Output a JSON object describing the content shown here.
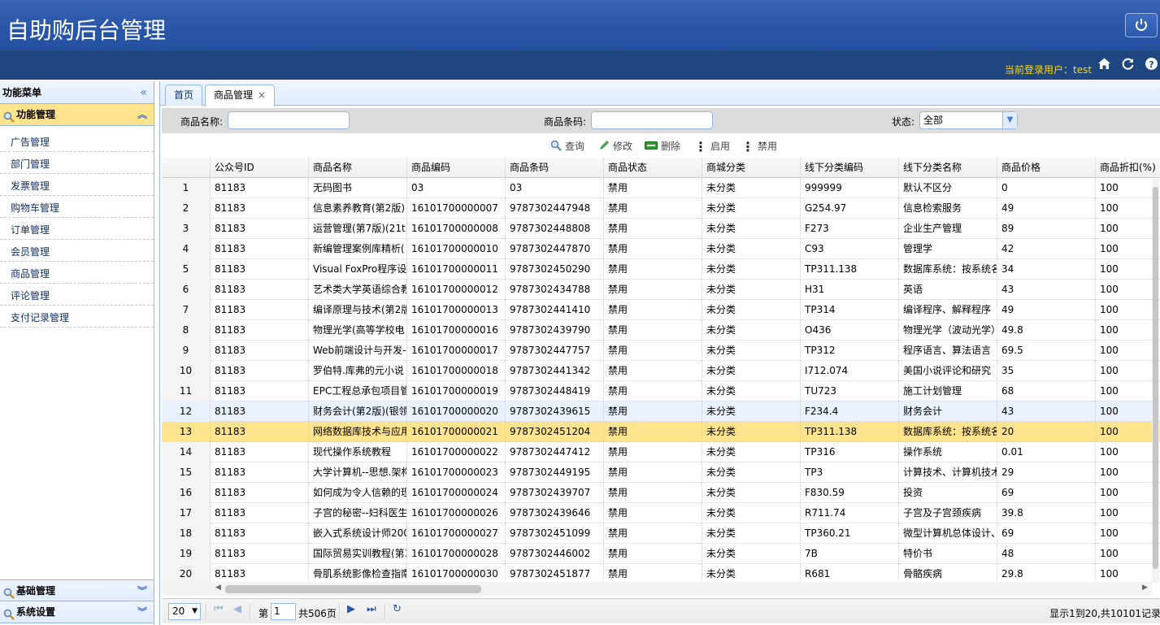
{
  "header": {
    "title": "自助购后台管理",
    "user_label": "当前登录用户：test"
  },
  "sidebar": {
    "title": "功能菜单",
    "active_group": "功能管理",
    "items": [
      "广告管理",
      "部门管理",
      "发票管理",
      "购物车管理",
      "订单管理",
      "会员管理",
      "商品管理",
      "评论管理",
      "支付记录管理"
    ],
    "bottom_groups": [
      "基础管理",
      "系统设置"
    ]
  },
  "tabs": [
    {
      "label": "首页"
    },
    {
      "label": "商品管理",
      "close": "×"
    }
  ],
  "search": {
    "name_label": "商品名称:",
    "barcode_label": "商品条码:",
    "status_label": "状态:",
    "status_value": "全部",
    "name_value": "",
    "barcode_value": ""
  },
  "toolbar": {
    "query": "查询",
    "edit": "修改",
    "delete": "删除",
    "enable": "启用",
    "disable": "禁用"
  },
  "grid": {
    "columns": [
      "公众号ID",
      "商品名称",
      "商品编码",
      "商品条码",
      "商品状态",
      "商城分类",
      "线下分类编码",
      "线下分类名称",
      "商品价格",
      "商品折扣(%)"
    ],
    "rows": [
      [
        "1",
        "81183",
        "无码图书",
        "03",
        "03",
        "禁用",
        "未分类",
        "999999",
        "默认不区分",
        "0",
        "100"
      ],
      [
        "2",
        "81183",
        "信息素养教育(第2版)",
        "16101700000007",
        "9787302447948",
        "禁用",
        "未分类",
        "G254.97",
        "信息检索服务",
        "49",
        "100"
      ],
      [
        "3",
        "81183",
        "运营管理(第7版)(21t",
        "16101700000008",
        "9787302448808",
        "禁用",
        "未分类",
        "F273",
        "企业生产管理",
        "89",
        "100"
      ],
      [
        "4",
        "81183",
        "新编管理案例库精析(",
        "16101700000010",
        "9787302447870",
        "禁用",
        "未分类",
        "C93",
        "管理学",
        "42",
        "100"
      ],
      [
        "5",
        "81183",
        "Visual FoxPro程序设",
        "16101700000011",
        "9787302450290",
        "禁用",
        "未分类",
        "TP311.138",
        "数据库系统：按系统名",
        "34",
        "100"
      ],
      [
        "6",
        "81183",
        "艺术类大学英语综合教",
        "16101700000012",
        "9787302434788",
        "禁用",
        "未分类",
        "H31",
        "英语",
        "43",
        "100"
      ],
      [
        "7",
        "81183",
        "编译原理与技术(第2版",
        "16101700000013",
        "9787302441410",
        "禁用",
        "未分类",
        "TP314",
        "编译程序、解释程序",
        "49",
        "100"
      ],
      [
        "8",
        "81183",
        "物理光学(高等学校电",
        "16101700000016",
        "9787302439790",
        "禁用",
        "未分类",
        "O436",
        "物理光学（波动光学）",
        "49.8",
        "100"
      ],
      [
        "9",
        "81183",
        "Web前端设计与开发-",
        "16101700000017",
        "9787302447757",
        "禁用",
        "未分类",
        "TP312",
        "程序语言、算法语言",
        "69.5",
        "100"
      ],
      [
        "10",
        "81183",
        "罗伯特.库弗的元小说",
        "16101700000018",
        "9787302441342",
        "禁用",
        "未分类",
        "I712.074",
        "美国小说评论和研究",
        "35",
        "100"
      ],
      [
        "11",
        "81183",
        "EPC工程总承包项目管",
        "16101700000019",
        "9787302448419",
        "禁用",
        "未分类",
        "TU723",
        "施工计划管理",
        "68",
        "100"
      ],
      [
        "12",
        "81183",
        "财务会计(第2版)(银领",
        "16101700000020",
        "9787302439615",
        "禁用",
        "未分类",
        "F234.4",
        "财务会计",
        "43",
        "100"
      ],
      [
        "13",
        "81183",
        "网络数据库技术与应用",
        "16101700000021",
        "9787302451204",
        "禁用",
        "未分类",
        "TP311.138",
        "数据库系统：按系统名",
        "20",
        "100"
      ],
      [
        "14",
        "81183",
        "现代操作系统教程",
        "16101700000022",
        "9787302447412",
        "禁用",
        "未分类",
        "TP316",
        "操作系统",
        "0.01",
        "100"
      ],
      [
        "15",
        "81183",
        "大学计算机--思想.架构",
        "16101700000023",
        "9787302449195",
        "禁用",
        "未分类",
        "TP3",
        "计算技术、计算机技术",
        "29",
        "100"
      ],
      [
        "16",
        "81183",
        "如何成为令人信赖的理",
        "16101700000024",
        "9787302439707",
        "禁用",
        "未分类",
        "F830.59",
        "投资",
        "69",
        "100"
      ],
      [
        "17",
        "81183",
        "子宫的秘密--妇科医生",
        "16101700000026",
        "9787302439646",
        "禁用",
        "未分类",
        "R711.74",
        "子宫及子宫颈疾病",
        "39.8",
        "100"
      ],
      [
        "18",
        "81183",
        "嵌入式系统设计师200",
        "16101700000027",
        "9787302451099",
        "禁用",
        "未分类",
        "TP360.21",
        "微型计算机总体设计、",
        "69",
        "100"
      ],
      [
        "19",
        "81183",
        "国际贸易实训教程(第3",
        "16101700000028",
        "9787302446002",
        "禁用",
        "未分类",
        "7B",
        "特价书",
        "48",
        "100"
      ],
      [
        "20",
        "81183",
        "骨肌系统影像检查指南",
        "16101700000030",
        "9787302451877",
        "禁用",
        "未分类",
        "R681",
        "骨骼疾病",
        "29.8",
        "100"
      ]
    ],
    "selected_row": 13,
    "hover_row": 12
  },
  "pager": {
    "page_size": "20",
    "page_prefix": "第",
    "page": "1",
    "page_total": "共506页",
    "info": "显示1到20,共10101记录"
  }
}
